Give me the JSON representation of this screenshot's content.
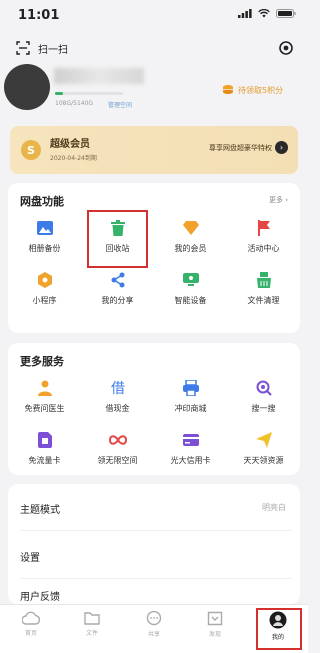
{
  "status_bar": {
    "time": "11:01"
  },
  "top": {
    "scan_label": "扫一扫"
  },
  "profile": {
    "storage": "108G/5140G",
    "manage": "管理空间",
    "coins_label": "待领取5积分"
  },
  "vip": {
    "title": "超级会员",
    "expiry": "2020-04-24到期",
    "promo": "尊享网盘超豪华特权"
  },
  "disk": {
    "title": "网盘功能",
    "more": "更多",
    "items": [
      {
        "label": "相册备份",
        "icon": "photo-backup-icon",
        "color": "#3c7be8"
      },
      {
        "label": "回收站",
        "icon": "trash-icon",
        "color": "#36b36a"
      },
      {
        "label": "我的会员",
        "icon": "diamond-icon",
        "color": "#f0a22b"
      },
      {
        "label": "活动中心",
        "icon": "flag-icon",
        "color": "#e64545"
      },
      {
        "label": "小程序",
        "icon": "hexagon-icon",
        "color": "#f0a22b"
      },
      {
        "label": "我的分享",
        "icon": "share-icon",
        "color": "#3c7be8"
      },
      {
        "label": "智能设备",
        "icon": "device-icon",
        "color": "#36b36a"
      },
      {
        "label": "文件清理",
        "icon": "broom-icon",
        "color": "#36b36a"
      }
    ]
  },
  "services": {
    "title": "更多服务",
    "items": [
      {
        "label": "免费问医生",
        "icon": "doctor-icon",
        "color": "#f0a22b"
      },
      {
        "label": "借现金",
        "icon": "loan-icon",
        "color": "#3c7be8"
      },
      {
        "label": "冲印商城",
        "icon": "printer-icon",
        "color": "#3c7be8"
      },
      {
        "label": "搜一搜",
        "icon": "search-icon",
        "color": "#7b4fd6"
      },
      {
        "label": "免流量卡",
        "icon": "sim-card-icon",
        "color": "#7b4fd6"
      },
      {
        "label": "领无限空间",
        "icon": "infinity-icon",
        "color": "#e64545"
      },
      {
        "label": "光大信用卡",
        "icon": "credit-card-icon",
        "color": "#7b4fd6"
      },
      {
        "label": "天天领资源",
        "icon": "paper-plane-icon",
        "color": "#f0c12b"
      }
    ]
  },
  "settings_list": [
    {
      "label": "主题模式",
      "value": "明亮白"
    },
    {
      "label": "设置",
      "value": ""
    },
    {
      "label": "用户反馈",
      "value": ""
    }
  ],
  "tabs": [
    {
      "label": "首页",
      "icon": "cloud-icon"
    },
    {
      "label": "文件",
      "icon": "folder-icon"
    },
    {
      "label": "共享",
      "icon": "chat-icon"
    },
    {
      "label": "发现",
      "icon": "discover-icon"
    },
    {
      "label": "我的",
      "icon": "profile-icon",
      "active": true
    }
  ]
}
